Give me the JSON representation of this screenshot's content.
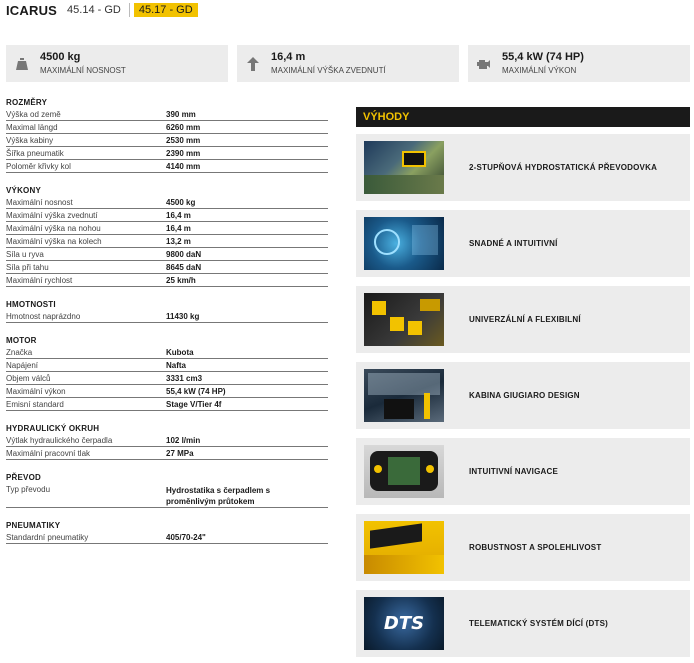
{
  "header": {
    "brand": "ICARUS",
    "models": [
      {
        "label": "45.14 - GD",
        "active": false
      },
      {
        "label": "45.17 - GD",
        "active": true
      }
    ]
  },
  "stats": [
    {
      "icon": "weight-icon",
      "value": "4500 kg",
      "label": "MAXIMÁLNÍ NOSNOST"
    },
    {
      "icon": "arrow-up-icon",
      "value": "16,4 m",
      "label": "MAXIMÁLNÍ VÝŠKA ZVEDNUTÍ"
    },
    {
      "icon": "engine-icon",
      "value": "55,4 kW (74 HP)",
      "label": "MAXIMÁLNÍ VÝKON"
    }
  ],
  "specs": [
    {
      "title": "ROZMĚRY",
      "rows": [
        {
          "label": "Výška od země",
          "value": "390 mm"
        },
        {
          "label": "Maximal längd",
          "value": "6260 mm"
        },
        {
          "label": "Výška kabiny",
          "value": "2530 mm"
        },
        {
          "label": "Šířka pneumatik",
          "value": "2390 mm"
        },
        {
          "label": "Poloměr křivky kol",
          "value": "4140 mm"
        }
      ]
    },
    {
      "title": "VÝKONY",
      "rows": [
        {
          "label": "Maximální nosnost",
          "value": "4500 kg"
        },
        {
          "label": "Maximální výška zvednutí",
          "value": "16,4 m"
        },
        {
          "label": "Maximální výška na nohou",
          "value": "16,4 m"
        },
        {
          "label": "Maximální výška na kolech",
          "value": "13,2 m"
        },
        {
          "label": "Síla u ryva",
          "value": "9800 daN"
        },
        {
          "label": "Síla při tahu",
          "value": "8645 daN"
        },
        {
          "label": "Maximální rychlost",
          "value": "25 km/h"
        }
      ]
    },
    {
      "title": "HMOTNOSTI",
      "rows": [
        {
          "label": "Hmotnost naprázdno",
          "value": "11430 kg"
        }
      ]
    },
    {
      "title": "MOTOR",
      "rows": [
        {
          "label": "Značka",
          "value": "Kubota"
        },
        {
          "label": "Napájení",
          "value": "Nafta"
        },
        {
          "label": "Objem válců",
          "value": "3331 cm3"
        },
        {
          "label": "Maximální výkon",
          "value": "55,4 kW (74 HP)"
        },
        {
          "label": "Emisní standard",
          "value": "Stage V/Tier 4f"
        }
      ]
    },
    {
      "title": "HYDRAULICKÝ OKRUH",
      "rows": [
        {
          "label": "Výtlak hydraulického čerpadla",
          "value": "102 l/min"
        },
        {
          "label": "Maximální pracovní tlak",
          "value": "27 MPa"
        }
      ]
    },
    {
      "title": "PŘEVOD",
      "rows": [
        {
          "label": "Typ převodu",
          "value": "Hydrostatika s čerpadlem s proměnlivým průtokem",
          "tall": true
        }
      ]
    },
    {
      "title": "PNEUMATIKY",
      "rows": [
        {
          "label": "Standardní pneumatiky",
          "value": "405/70-24\""
        }
      ]
    }
  ],
  "benefits": {
    "title": "VÝHODY",
    "items": [
      {
        "label": "2-STUPŇOVÁ HYDROSTATICKÁ PŘEVODOVKA",
        "img": "transmission-photo"
      },
      {
        "label": "SNADNÉ A INTUITIVNÍ",
        "img": "cabin-controls-photo"
      },
      {
        "label": "UNIVERZÁLNÍ A FLEXIBILNÍ",
        "img": "attachments-photo"
      },
      {
        "label": "KABINA GIUGIARO DESIGN",
        "img": "cabin-interior-photo"
      },
      {
        "label": "INTUITIVNÍ NAVIGACE",
        "img": "display-photo"
      },
      {
        "label": "ROBUSTNOST A SPOLEHLIVOST",
        "img": "boom-photo"
      },
      {
        "label": "TELEMATICKÝ SYSTÉM DÍCÍ (DTS)",
        "img": "dts-photo",
        "caption": "DTS"
      }
    ]
  },
  "colors": {
    "accent": "#f2c200",
    "dark": "#1a1a1a",
    "panel": "#ececec"
  }
}
